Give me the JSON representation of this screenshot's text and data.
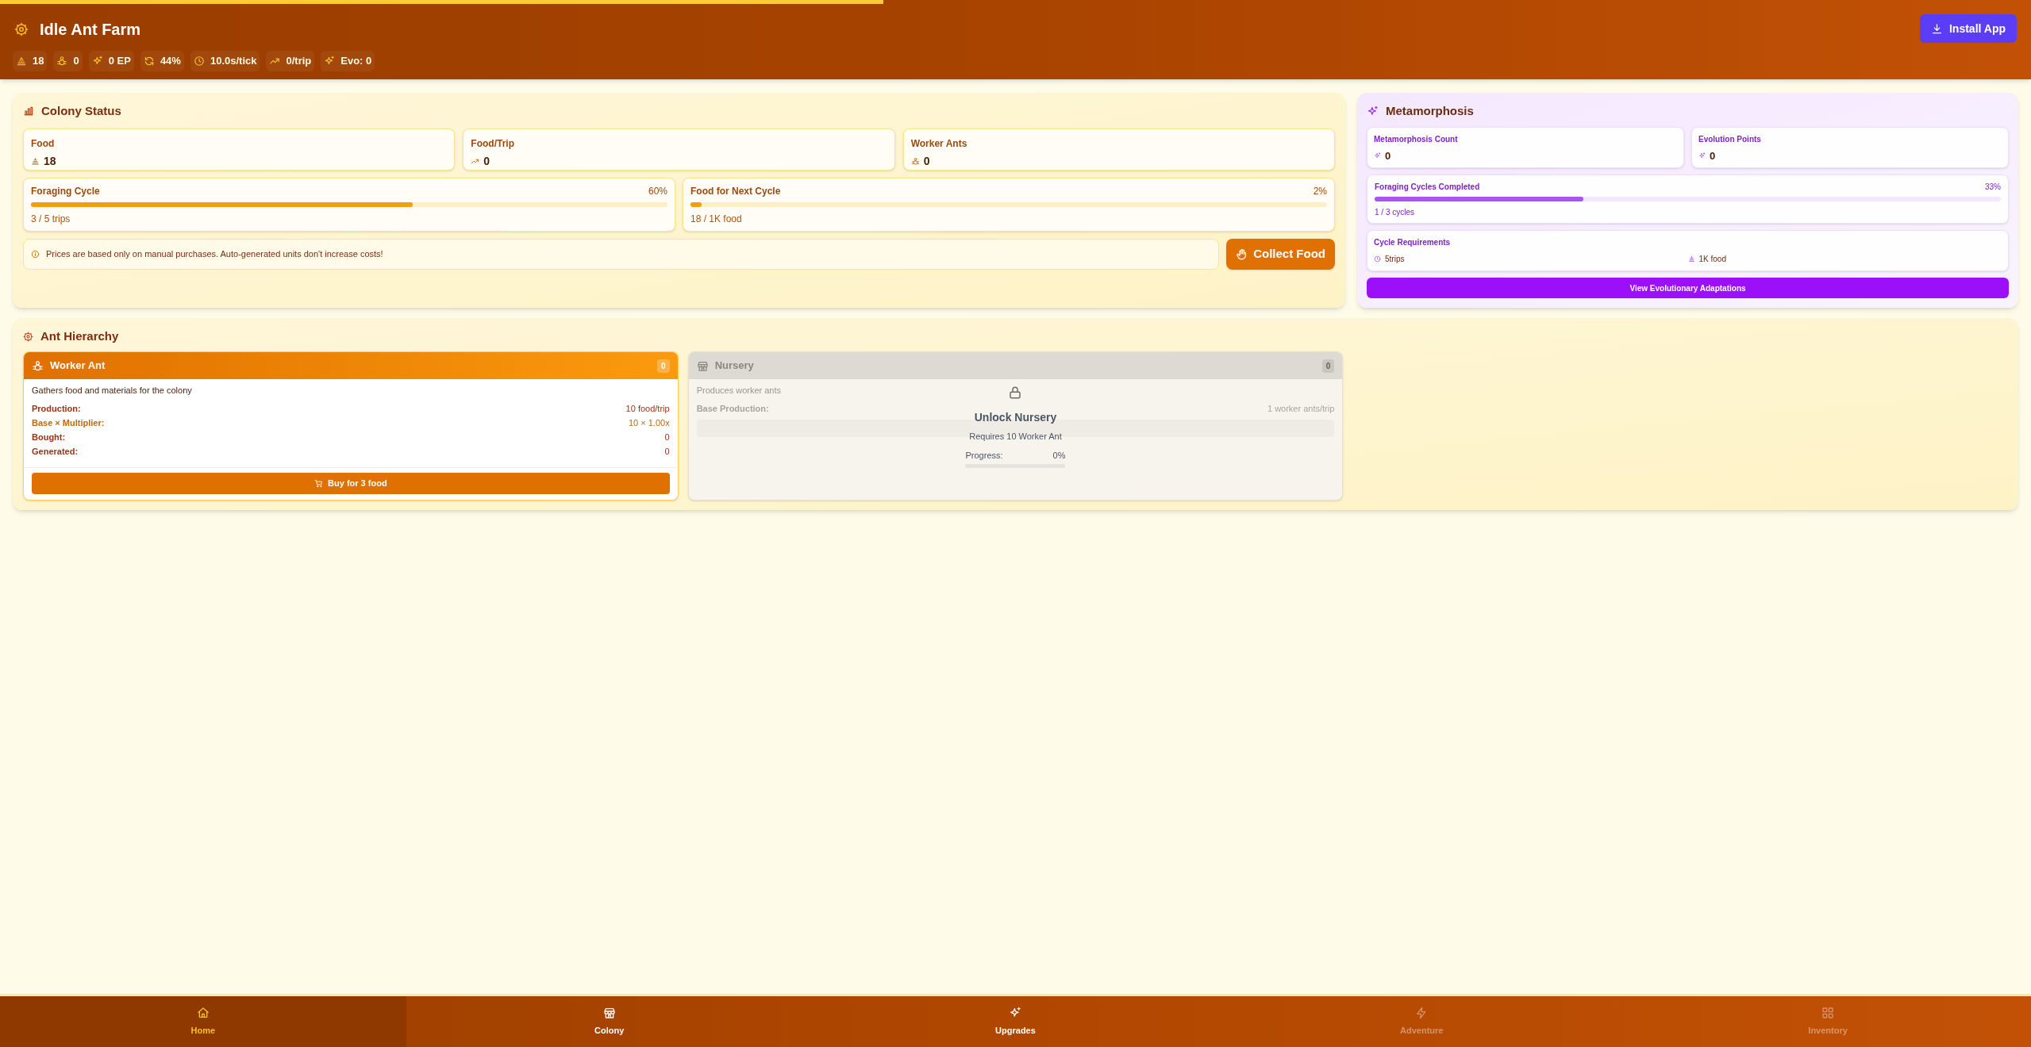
{
  "loading_bar": {
    "level": 0.435
  },
  "title": "Idle Ant Farm",
  "stats": [
    {
      "kind": "food",
      "text": "18"
    },
    {
      "kind": "ant",
      "text": "0"
    },
    {
      "kind": "sparkle",
      "text": "0 EP"
    },
    {
      "kind": "cycle",
      "text": "44%"
    },
    {
      "kind": "clock",
      "text": "10.0s/tick"
    },
    {
      "kind": "trend",
      "text": "0/trip"
    },
    {
      "kind": "sparkle",
      "text": "Evo: 0"
    }
  ],
  "install_button": "Install App",
  "colony_status": {
    "title": "Colony Status",
    "stats": [
      {
        "kind": "food",
        "label": "Food",
        "value": "18"
      },
      {
        "kind": "trend",
        "label": "Food/Trip",
        "value": "0"
      },
      {
        "kind": "ant",
        "label": "Worker Ants",
        "value": "0"
      }
    ],
    "progress": [
      {
        "label": "Foraging Cycle",
        "percent": "60%",
        "level": 0.6,
        "detail": "3 / 5 trips"
      },
      {
        "label": "Food for Next Cycle",
        "percent": "2%",
        "level": 0.018,
        "detail": "18 / 1K food"
      }
    ],
    "notice": "Prices are based only on manual purchases. Auto-generated units don't increase costs!",
    "collect_button": "Collect Food"
  },
  "metamorphosis": {
    "title": "Metamorphosis",
    "stats": [
      {
        "label": "Metamorphosis Count",
        "value": "0"
      },
      {
        "label": "Evolution Points",
        "value": "0"
      }
    ],
    "progress": {
      "label": "Foraging Cycles Completed",
      "percent": "33%",
      "level": 0.333,
      "detail": "1 / 3 cycles"
    },
    "requirements": {
      "title": "Cycle Requirements",
      "items": [
        {
          "kind": "clock",
          "text": "5trips"
        },
        {
          "kind": "food",
          "text": "1K food"
        }
      ]
    },
    "button": "View Evolutionary Adaptations"
  },
  "hierarchy": {
    "title": "Ant Hierarchy",
    "units": [
      {
        "name": "Worker Ant",
        "count": "0",
        "locked": false,
        "description": "Gathers food and materials for the colony",
        "rows": [
          {
            "label": "Production:",
            "value": "10 food/trip",
            "muted": false
          },
          {
            "label": "Base × Multiplier:",
            "value": "10 × 1.00x",
            "muted": true
          },
          {
            "label": "Bought:",
            "value": "0",
            "muted": false
          },
          {
            "label": "Generated:",
            "value": "0",
            "muted": false
          }
        ],
        "button": "Buy for 3 food"
      },
      {
        "name": "Nursery",
        "count": "0",
        "locked": true,
        "description": "Produces worker ants",
        "rows": [
          {
            "label": "Base Production:",
            "value": "1 worker ants/trip",
            "muted": false
          }
        ],
        "unlock": {
          "title": "Unlock Nursery",
          "requirement": "Requires 10 Worker Ant",
          "progress_label": "Progress:",
          "progress_value": "0%",
          "level": 0
        }
      }
    ]
  },
  "nav": [
    {
      "kind": "home",
      "label": "Home",
      "selected": true,
      "disabled": false
    },
    {
      "kind": "store",
      "label": "Colony",
      "selected": false,
      "disabled": false
    },
    {
      "kind": "sparkle",
      "label": "Upgrades",
      "selected": false,
      "disabled": false
    },
    {
      "kind": "zap",
      "label": "Adventure",
      "selected": false,
      "disabled": true
    },
    {
      "kind": "grid",
      "label": "Inventory",
      "selected": false,
      "disabled": true
    }
  ]
}
